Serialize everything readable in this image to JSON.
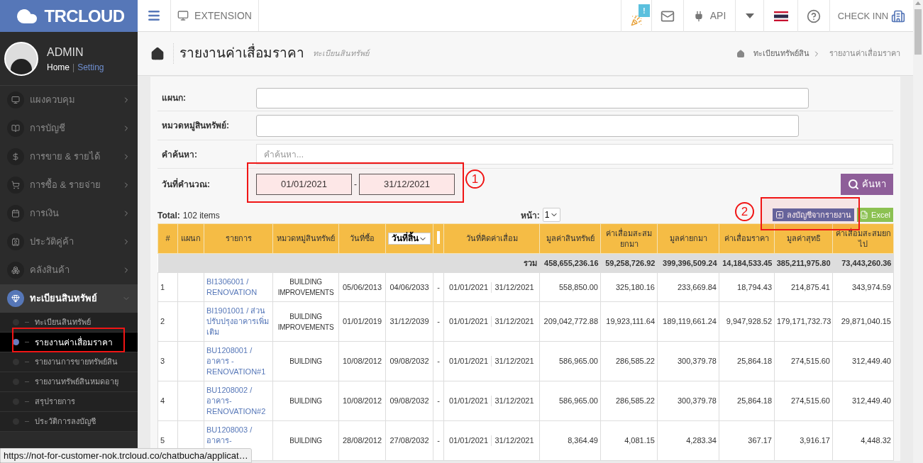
{
  "brand": "TRCLOUD",
  "topbar": {
    "extension": "EXTENSION",
    "notification_badge": "!",
    "api": "API",
    "check_inn": "CHECK INN"
  },
  "user": {
    "name": "ADMIN",
    "separator": "|",
    "links": [
      {
        "label": "Home",
        "selected": true
      },
      {
        "label": "Setting",
        "selected": false
      }
    ]
  },
  "sidebar": {
    "items": [
      {
        "label": "แผงควบคุม",
        "expanded": false
      },
      {
        "label": "การบัญชี",
        "expanded": false
      },
      {
        "label": "การขาย & รายได้",
        "expanded": false
      },
      {
        "label": "การซื้อ & รายจ่าย",
        "expanded": false
      },
      {
        "label": "การเงิน",
        "expanded": false
      },
      {
        "label": "ประวัติคู่ค้า",
        "expanded": false
      },
      {
        "label": "คลังสินค้า",
        "expanded": false
      },
      {
        "label": "ทะเบียนสินทรัพย์",
        "expanded": true,
        "children": [
          {
            "label": "ทะเบียนสินทรัพย์",
            "selected": false
          },
          {
            "label": "รายงานค่าเสื่อมราคา",
            "selected": true
          },
          {
            "label": "รายงานการขายทรัพย์สิน",
            "selected": false
          },
          {
            "label": "รายงานทรัพย์สินหมดอายุ",
            "selected": false
          },
          {
            "label": "สรุปรายการ",
            "selected": false
          },
          {
            "label": "ประวัติการลงบัญชี",
            "selected": false
          }
        ]
      }
    ]
  },
  "page": {
    "title": "รายงานค่าเสื่อมราคา",
    "subtitle": "ทะเบียนสินทรัพย์",
    "breadcrumb": [
      "ทะเบียนทรัพย์สิน",
      "รายงานค่าเสื่อมราคา"
    ]
  },
  "filters": {
    "department": {
      "label": "แผนก:"
    },
    "category": {
      "label": "หมวดหมู่สินทรัพย์:"
    },
    "keyword": {
      "label": "คำค้นหา:",
      "placeholder": "คำค้นหา..."
    },
    "date_range": {
      "label": "วันที่คำนวณ:",
      "from": "01/01/2021",
      "separator": "-",
      "to": "31/12/2021"
    },
    "search_button": "ค้นหา"
  },
  "toolbar": {
    "total_label": "Total:",
    "total": "102 items",
    "page_label": "หน้า:",
    "page": "1",
    "post_button": "ลงบัญชีจากรายงาน",
    "excel_button": "Excel"
  },
  "annotations": [
    {
      "label": "1"
    },
    {
      "label": "2"
    }
  ],
  "table": {
    "columns": [
      {
        "label": "#",
        "kind": "text"
      },
      {
        "label": "แผนก",
        "kind": "text"
      },
      {
        "label": "รายการ",
        "kind": "text"
      },
      {
        "label": "หมวดหมู่สินทรัพย์",
        "kind": "text"
      },
      {
        "label": "วันที่ซื้อ",
        "kind": "text"
      },
      {
        "label": "วันที่สิ้น",
        "kind": "select"
      },
      {
        "kind": "blank"
      },
      {
        "label": "วันที่คิดค่าเสื่อม",
        "kind": "range"
      },
      {
        "label": "มูลค่าสินทรัพย์",
        "kind": "text"
      },
      {
        "label": "ค่าเสื่อมสะสมยกมา",
        "kind": "text"
      },
      {
        "label": "มูลค่ายกมา",
        "kind": "text"
      },
      {
        "label": "ค่าเสื่อมราคา",
        "kind": "text"
      },
      {
        "label": "มูลค่าสุทธิ",
        "kind": "text"
      },
      {
        "label": "ค่าเสื่อมสะสมยกไป",
        "kind": "text"
      }
    ],
    "total_row": {
      "label": "รวม",
      "values": [
        "458,655,236.16",
        "59,258,726.92",
        "399,396,509.24",
        "14,184,533.45",
        "385,211,975.80",
        "73,443,260.36"
      ]
    },
    "rows": [
      {
        "no": "1",
        "item": "BI1306001 / RENOVATION",
        "category": "BUILDING IMPROVEMENTS",
        "purchase_date": "05/06/2013",
        "end_date": "04/06/2033",
        "dash": "-",
        "from": "01/01/2021",
        "to": "31/12/2021",
        "values": [
          "558,850.00",
          "325,180.16",
          "233,669.84",
          "18,794.43",
          "214,875.41",
          "343,974.59"
        ]
      },
      {
        "no": "2",
        "item": "BI1901001 / ส่วนปรับปรุงอาคารเพิ่มเติม",
        "category": "BUILDING IMPROVEMENTS",
        "purchase_date": "01/01/2019",
        "end_date": "31/12/2039",
        "dash": "-",
        "from": "01/01/2021",
        "to": "31/12/2021",
        "values": [
          "209,042,772.88",
          "19,923,111.64",
          "189,119,661.24",
          "9,947,928.52",
          "179,171,732.73",
          "29,871,040.15"
        ]
      },
      {
        "no": "3",
        "item": "BU1208001 / อาคาร - RENOVATION#1",
        "category": "BUILDING",
        "purchase_date": "10/08/2012",
        "end_date": "09/08/2032",
        "dash": "-",
        "from": "01/01/2021",
        "to": "31/12/2021",
        "values": [
          "586,965.00",
          "286,585.22",
          "300,379.78",
          "25,864.18",
          "274,515.60",
          "312,449.40"
        ]
      },
      {
        "no": "4",
        "item": "BU1208002 / อาคาร-RENOVATION#2",
        "category": "BUILDING",
        "purchase_date": "10/08/2012",
        "end_date": "09/08/2032",
        "dash": "-",
        "from": "01/01/2021",
        "to": "31/12/2021",
        "values": [
          "586,965.00",
          "286,585.22",
          "300,379.78",
          "25,864.18",
          "274,515.60",
          "312,449.40"
        ]
      },
      {
        "no": "5",
        "item": "BU1208003 / อาคาร-",
        "category": "BUILDING",
        "purchase_date": "28/08/2012",
        "end_date": "27/08/2032",
        "dash": "-",
        "from": "01/01/2021",
        "to": "31/12/2021",
        "values": [
          "8,364.49",
          "4,081.15",
          "4,283.34",
          "367.17",
          "3,916.17",
          "4,448.32"
        ]
      }
    ]
  },
  "status_bar": "https://not-for-customer-nok.trcloud.co/chatbucha/applicat…"
}
